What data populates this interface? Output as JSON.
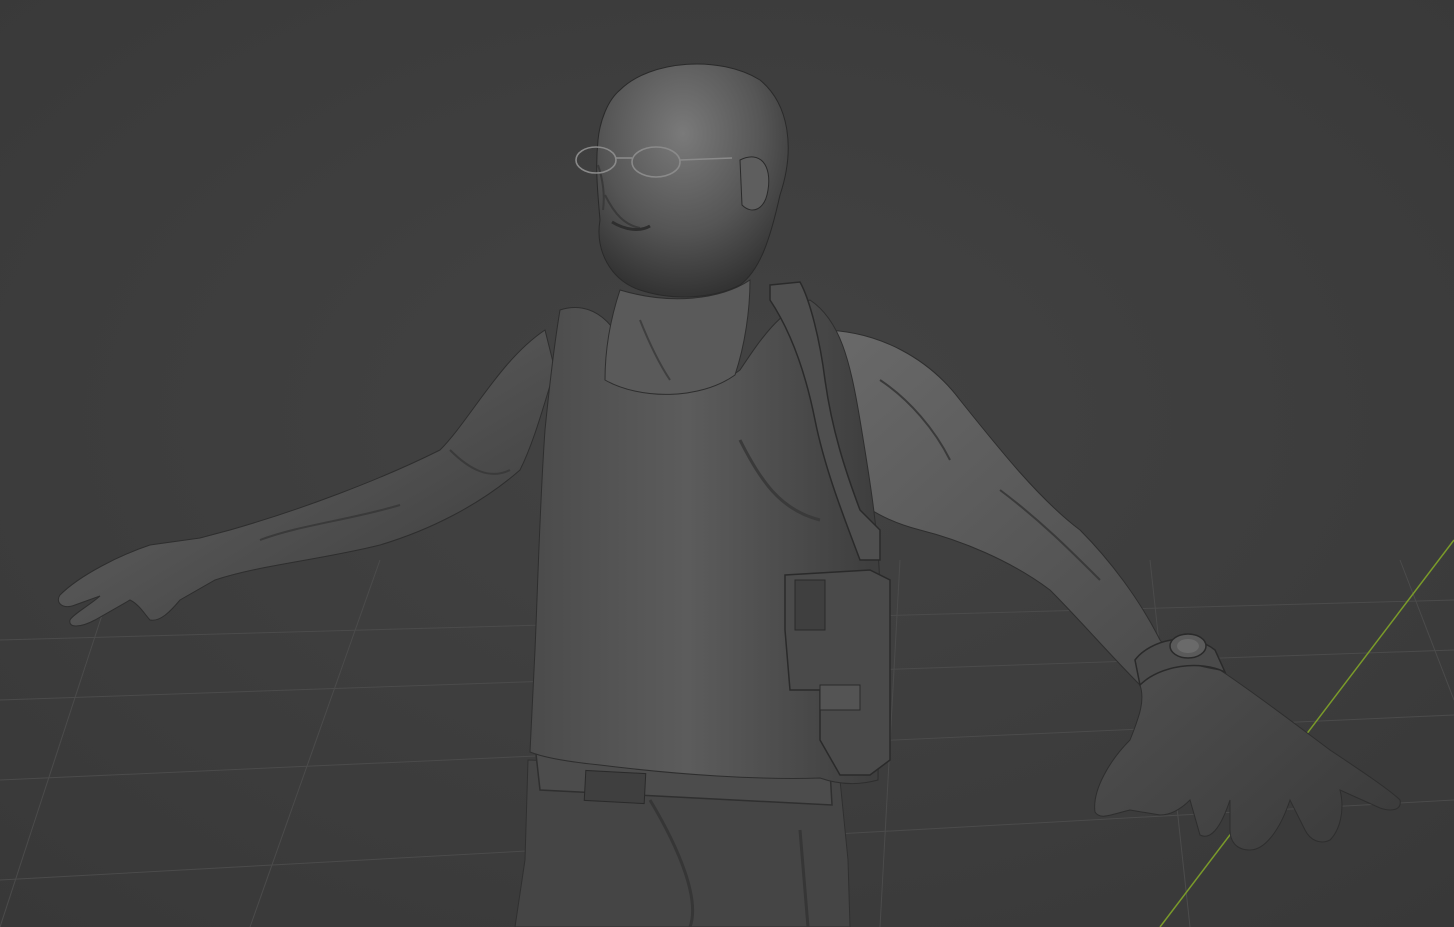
{
  "viewport": {
    "background_color": "#3d3d3d",
    "grid_line_color": "#4a4a4a",
    "y_axis_color": "#7a9a2a",
    "shading": "matcap-clay",
    "model": {
      "subject": "sculpted-male-figure-in-tank-top",
      "pose": "a-pose",
      "accessories": [
        "glasses-icon",
        "shoulder-holster-icon",
        "wristwatch-icon",
        "belt-icon"
      ]
    }
  }
}
